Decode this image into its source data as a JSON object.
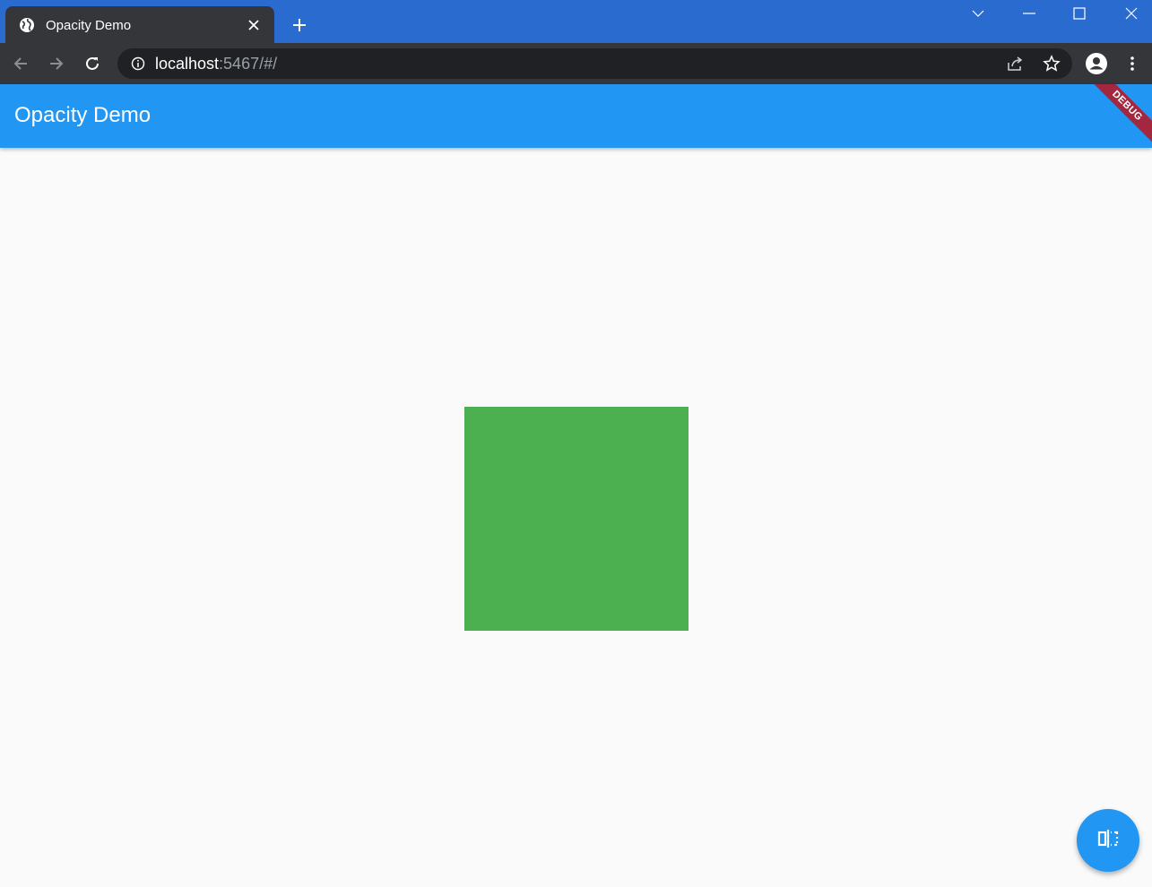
{
  "browser": {
    "tab": {
      "title": "Opacity Demo",
      "icon": "globe-icon"
    },
    "new_tab_icon": "plus-icon",
    "window_controls": [
      "chevron-down-icon",
      "minimize-icon",
      "maximize-icon",
      "close-icon"
    ],
    "toolbar": {
      "back_icon": "arrow-left-icon",
      "forward_icon": "arrow-right-icon",
      "reload_icon": "reload-icon",
      "url_host": "localhost",
      "url_rest": ":5467/#/",
      "site_info_icon": "info-icon",
      "share_icon": "share-icon",
      "bookmark_icon": "star-icon",
      "profile_icon": "person-icon",
      "menu_icon": "kebab-menu-icon"
    }
  },
  "app": {
    "title": "Opacity Demo",
    "debug_banner": "DEBUG",
    "colors": {
      "primary": "#2196f3",
      "box": "#4caf50",
      "background": "#fafafa",
      "debug": "#a3283f"
    },
    "fab_icon": "flip-icon"
  }
}
